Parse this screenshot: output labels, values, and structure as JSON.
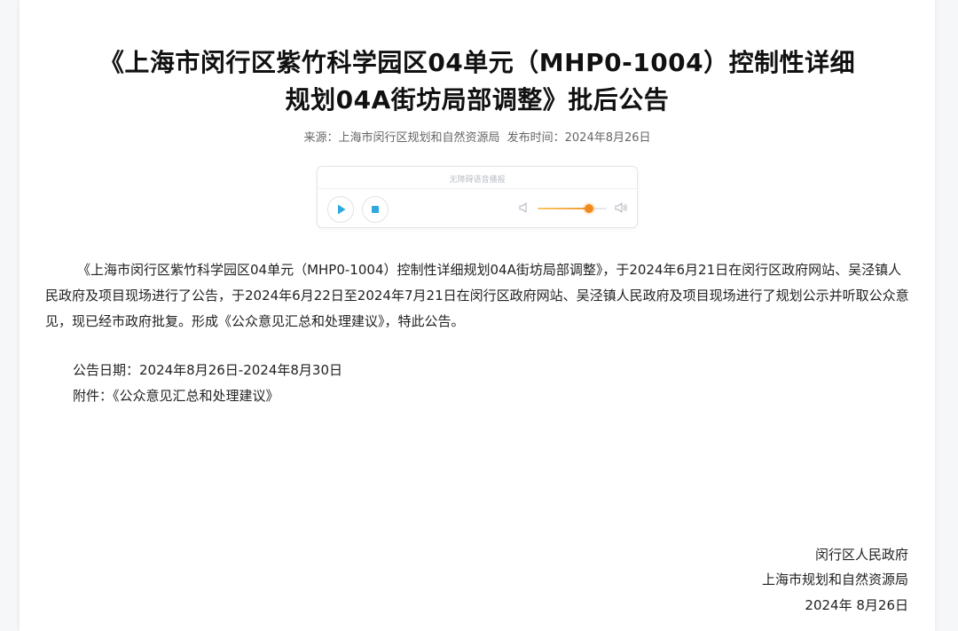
{
  "article": {
    "title_line1": "《上海市闵行区紫竹科学园区04单元（MHP0-1004）控制性详细",
    "title_line2": "规划04A街坊局部调整》批后公告",
    "source": "来源：上海市闵行区规划和自然资源局",
    "publish_time": "发布时间：2024年8月26日",
    "body": "《上海市闵行区紫竹科学园区04单元（MHP0-1004）控制性详细规划04A街坊局部调整》，于2024年6月21日在闵行区政府网站、吴泾镇人民政府及项目现场进行了公告，于2024年6月22日至2024年7月21日在闵行区政府网站、吴泾镇人民政府及项目现场进行了规划公示并听取公众意见，现已经市政府批复。形成《公众意见汇总和处理建议》，特此公告。",
    "notice_date": "公告日期：2024年8月26日-2024年8月30日",
    "attachment_label": "附件：",
    "attachment_link": "《公众意见汇总和处理建议》",
    "signature_1": "闵行区人民政府",
    "signature_2": "上海市规划和自然资源局",
    "signature_3": "2024年 8月26日"
  },
  "player": {
    "label": "无障碍语音播报",
    "play_icon": "play-icon",
    "stop_icon": "stop-icon",
    "volume_low_icon": "volume-low-icon",
    "volume_high_icon": "volume-high-icon",
    "volume_level": 0.74,
    "accent_color": "#2fa8e0",
    "volume_color": "#f08a1c"
  }
}
